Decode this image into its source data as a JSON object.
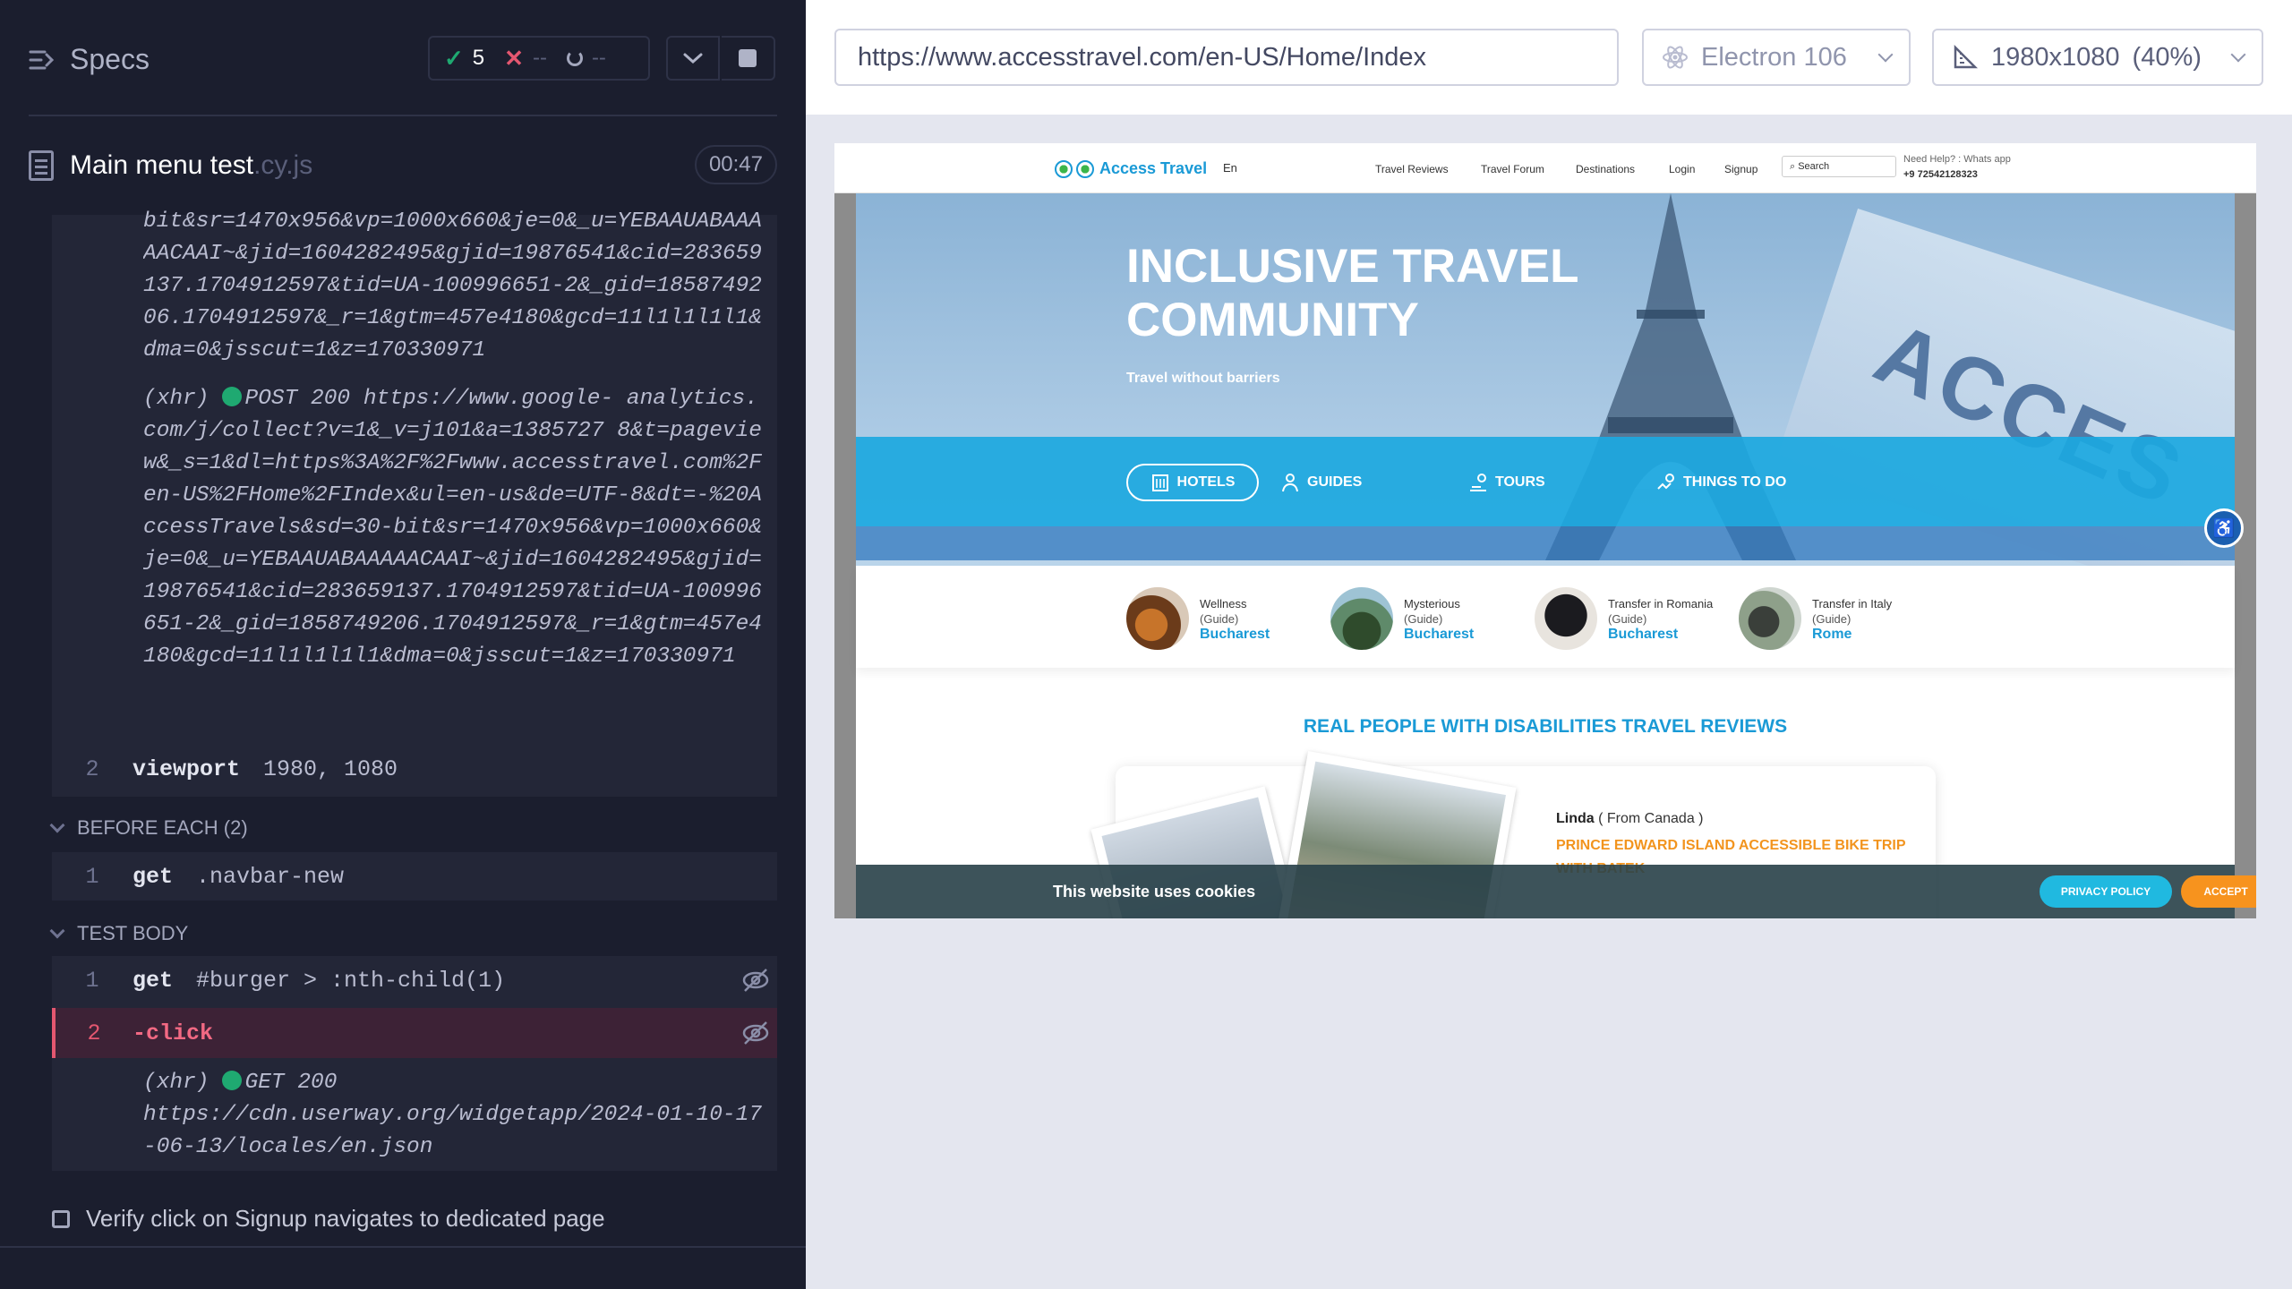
{
  "reporter": {
    "specs_label": "Specs",
    "stats": {
      "passed": "5",
      "failed": "--",
      "pending": "--"
    },
    "spec": {
      "name": "Main menu test",
      "ext": ".cy.js",
      "timer": "00:47"
    },
    "log_top": "bit&sr=1470x956&vp=1000x660&je=0&_u=YEBAAUABAAAAACAAI~&jid=1604282495&gjid=19876541&cid=283659137.1704912597&tid=UA-100996651-2&_gid=1858749206.1704912597&_r=1&gtm=457e4180&gcd=11l1l1l1l1&dma=0&jsscut=1&z=170330971",
    "xhr1": {
      "prefix": "(xhr)",
      "method": "POST 200 https://www.google-",
      "rest": "analytics.com/j/collect?v=1&_v=j101&a=1385727 8&t=pageview&_s=1&dl=https%3A%2F%2Fwww.accesstravel.com%2Fen-US%2FHome%2FIndex&ul=en-us&de=UTF-8&dt=-%20AccessTravels&sd=30-bit&sr=1470x956&vp=1000x660&je=0&_u=YEBAAUABAAAAACAAI~&jid=1604282495&gjid=19876541&cid=283659137.1704912597&tid=UA-100996651-2&_gid=1858749206.1704912597&_r=1&gtm=457e4180&gcd=11l1l1l1l1&dma=0&jsscut=1&z=170330971"
    },
    "viewport_cmd": {
      "num": "2",
      "name": "viewport",
      "arg": "1980, 1080"
    },
    "before_each": {
      "header": "BEFORE EACH (2)",
      "cmd": {
        "num": "1",
        "name": "get",
        "arg": ".navbar-new"
      }
    },
    "test_body": {
      "header": "TEST BODY",
      "cmd1": {
        "num": "1",
        "name": "get",
        "arg": "#burger > :nth-child(1)"
      },
      "cmd2": {
        "num": "2",
        "name": "-click"
      },
      "xhr": {
        "prefix": "(xhr)",
        "method": "GET 200",
        "url": "https://cdn.userway.org/widgetapp/2024-01-10-17-06-13/locales/en.json"
      }
    },
    "next_test": "Verify click on Signup navigates to dedicated page"
  },
  "aut": {
    "url": "https://www.accesstravel.com/en-US/Home/Index",
    "browser": "Electron 106",
    "viewport": "1980x1080",
    "zoom": "(40%)"
  },
  "site": {
    "logo": "Access Travel",
    "lang": "En",
    "nav": [
      "Travel Reviews",
      "Travel Forum",
      "Destinations",
      "Login",
      "Signup"
    ],
    "search_placeholder": "Search",
    "help_label": "Need Help? : Whats app",
    "help_phone": "+9 72542128323",
    "hero_title_1": "INCLUSIVE TRAVEL",
    "hero_title_2": "COMMUNITY",
    "hero_subtitle": "Travel without barriers",
    "hero_sign": "ACCES",
    "categories": [
      "HOTELS",
      "GUIDES",
      "TOURS",
      "THINGS TO DO"
    ],
    "guides": [
      {
        "title": "Wellness",
        "sub": "(Guide)",
        "city": "Bucharest"
      },
      {
        "title": "Mysterious",
        "sub": "(Guide)",
        "city": "Bucharest"
      },
      {
        "title": "Transfer in Romania",
        "sub": "(Guide)",
        "city": "Bucharest"
      },
      {
        "title": "Transfer in Italy",
        "sub": "(Guide)",
        "city": "Rome"
      }
    ],
    "reviews_heading": "REAL PEOPLE WITH DISABILITIES TRAVEL REVIEWS",
    "review": {
      "name": "Linda",
      "from": "( From Canada )",
      "trip": "PRINCE EDWARD ISLAND ACCESSIBLE BIKE TRIP WITH BATEK"
    },
    "cookie": {
      "message": "This website uses cookies",
      "privacy": "PRIVACY POLICY",
      "accept": "ACCEPT"
    }
  },
  "colors": {
    "reporter_bg": "#1b1e2e",
    "pass": "#1fa971",
    "fail": "#e45770",
    "site_accent": "#1a9ad6",
    "site_orange": "#f2941e"
  }
}
